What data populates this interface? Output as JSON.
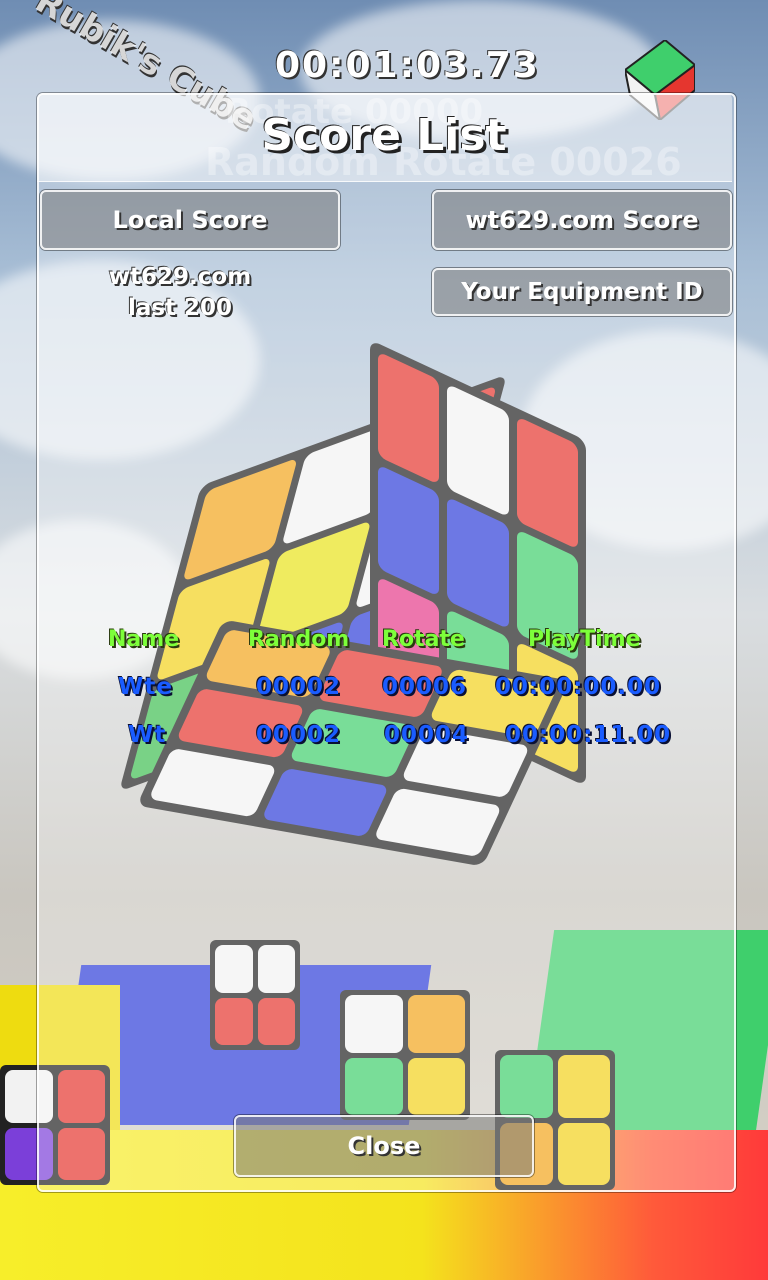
{
  "hud": {
    "timer": "00:01:03.73",
    "logo_text": "Rubik's Cube",
    "rotate_text": "Rotate 00000",
    "random_rotate_text": "Random Rotate 00026"
  },
  "dialog": {
    "title": "Score List",
    "local_score_button": "Local Score",
    "web_score_button": "wt629.com Score",
    "equipment_id_button": "Your Equipment ID",
    "source_line1": "wt629.com",
    "source_line2": "last 200",
    "close_button": "Close"
  },
  "score_table": {
    "headers": [
      "Name",
      "Random",
      "Rotate",
      "PlayTime"
    ],
    "rows": [
      {
        "name": "Wte",
        "random": "00002",
        "rotate": "00006",
        "playtime": "00:00:00.00"
      },
      {
        "name": "Wt",
        "random": "00002",
        "rotate": "00004",
        "playtime": "00:00:11.00"
      }
    ]
  },
  "colors": {
    "header_green": "#7dff3a",
    "cell_blue": "#1a5cff"
  }
}
